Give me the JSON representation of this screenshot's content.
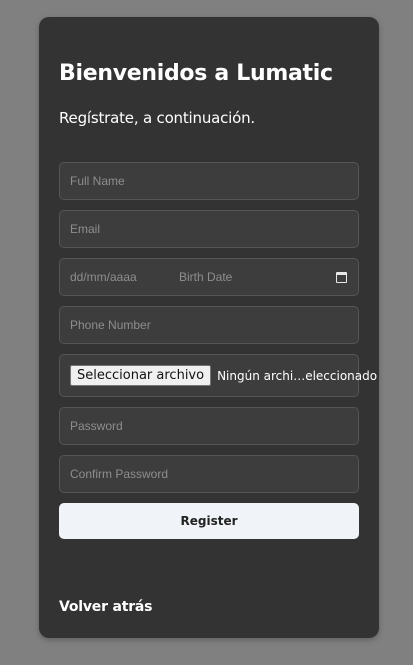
{
  "form": {
    "title": "Bienvenidos a Lumatic",
    "subtitle": "Regístrate, a continuación.",
    "full_name_placeholder": "Full Name",
    "email_placeholder": "Email",
    "date_format": "dd/mm/aaaa",
    "birth_date_label": "Birth Date",
    "phone_placeholder": "Phone Number",
    "file_button": "Seleccionar archivo",
    "file_status": "Ningún archi…eleccionado",
    "password_placeholder": "Password",
    "confirm_password_placeholder": "Confirm Password",
    "register_button": "Register",
    "back_link": "Volver atrás"
  },
  "colors": {
    "page_background": "#808080",
    "card_background": "#333333",
    "field_background": "#3d3d3d",
    "button_background": "#f0f4f8"
  },
  "icons": {
    "date_picker": "calendar-icon"
  }
}
